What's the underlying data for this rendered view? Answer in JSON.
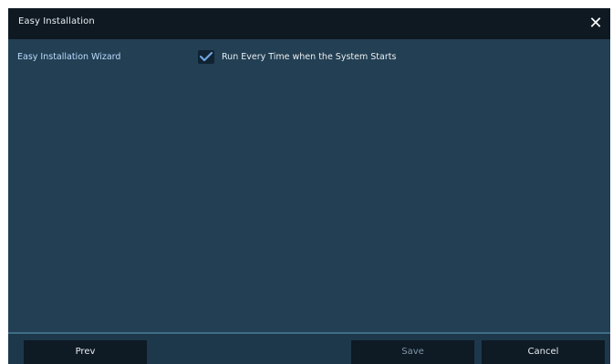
{
  "dialog": {
    "title": "Easy Installation",
    "close_icon": "close-icon"
  },
  "settings": {
    "wizard_label": "Easy Installation Wizard",
    "run_every_time_label": "Run Every Time when the System Starts",
    "run_every_time_checked": true
  },
  "footer": {
    "prev_label": "Prev",
    "save_label": "Save",
    "cancel_label": "Cancel"
  },
  "colors": {
    "background": "#213f53",
    "titlebar": "#0e1922",
    "accent_label": "#b9dcff",
    "button": "#0e1a24"
  }
}
